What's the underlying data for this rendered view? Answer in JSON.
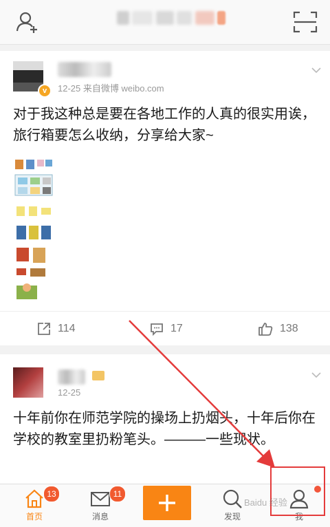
{
  "posts": [
    {
      "meta": "12-25  来自微博 weibo.com",
      "verified_mark": "v",
      "content": "对于我这种总是要在各地工作的人真的很实用诶，旅行箱要怎么收纳，分享给大家~",
      "actions": {
        "repost": "114",
        "comment": "17",
        "like": "138"
      }
    },
    {
      "meta": "12-25",
      "content": "十年前你在师范学院的操场上扔烟头，十年后你在学校的教室里扔粉笔头。———一些现状。"
    }
  ],
  "tabbar": {
    "home": {
      "label": "首页",
      "badge": "13"
    },
    "messages": {
      "label": "消息",
      "badge": "11"
    },
    "discover": {
      "label": "发现"
    },
    "me": {
      "label": "我"
    }
  },
  "watermark": "Baidu 经验",
  "colors": {
    "accent": "#f98514",
    "badge": "#f15a2f",
    "highlight": "#e43b3b"
  }
}
